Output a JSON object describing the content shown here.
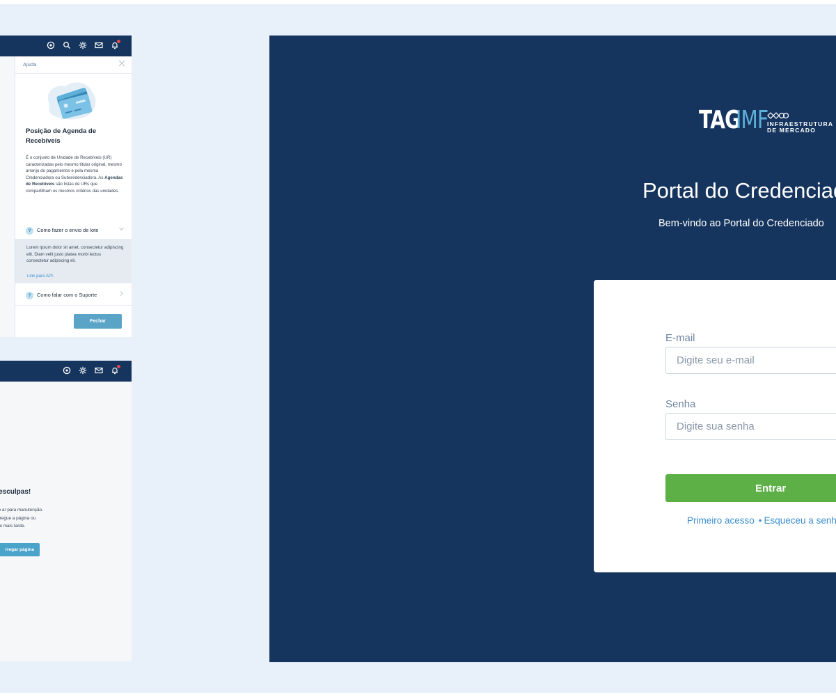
{
  "help_mockup": {
    "panel_title": "Ajuda",
    "heading": "Posição de Agenda de Recebíveis",
    "body_part1": "É o conjunto de Unidade de Recebíveis (UR) caracterizadas pelo mesmo titular original, mesmo arranjo de pagamentos e pela mesma Credenciadora ou Subcredenciadora. As ",
    "body_bold1": "Agendas de Recebíveis",
    "body_part2": " são listas de URs que compartilham os mesmos critérios das unidades.",
    "accordion": [
      {
        "label": "Como fazer o envio de lote"
      },
      {
        "label": "Como falar com o Suporte"
      }
    ],
    "accordion_open_text": "Lorem ipsum dolor sit amet, consectetur adipiscing elit. Diam velit justo platea morbi lectus consectetur adipiscing eli.",
    "accordion_link": "Link para API.",
    "close_button": "Fechar"
  },
  "maintenance_mockup": {
    "title": "desculpas!",
    "body_line1": "do ar para manutenção.",
    "body_line2": "arregue a página ou",
    "body_line3": "nte mais tarde.",
    "reload_button": "rregar página"
  },
  "login": {
    "logo_tag": "TAG",
    "logo_imf": "IMF",
    "logo_sub1": "INFRAESTRUTURA",
    "logo_sub2": "DE MERCADO",
    "title": "Portal do Credenciado",
    "subtitle": "Bem-vindo ao Portal do Credenciado",
    "email_label": "E-mail",
    "email_placeholder": "Digite seu e-mail",
    "password_label": "Senha",
    "password_placeholder": "Digite sua senha",
    "submit_button": "Entrar",
    "first_access_link": "Primeiro acesso",
    "forgot_password_link": "Esqueceu a senha?",
    "link_separator": "•"
  },
  "colors": {
    "navy": "#16355e",
    "background": "#e8f0fa",
    "green_button": "#5db046",
    "teal_button": "#5aa5c7",
    "link_blue": "#3d8fd1"
  },
  "icons": [
    "help-icon",
    "search-icon",
    "settings-icon",
    "mail-icon",
    "bell-icon",
    "close-icon",
    "chevron-down-icon",
    "chevron-right-icon"
  ]
}
